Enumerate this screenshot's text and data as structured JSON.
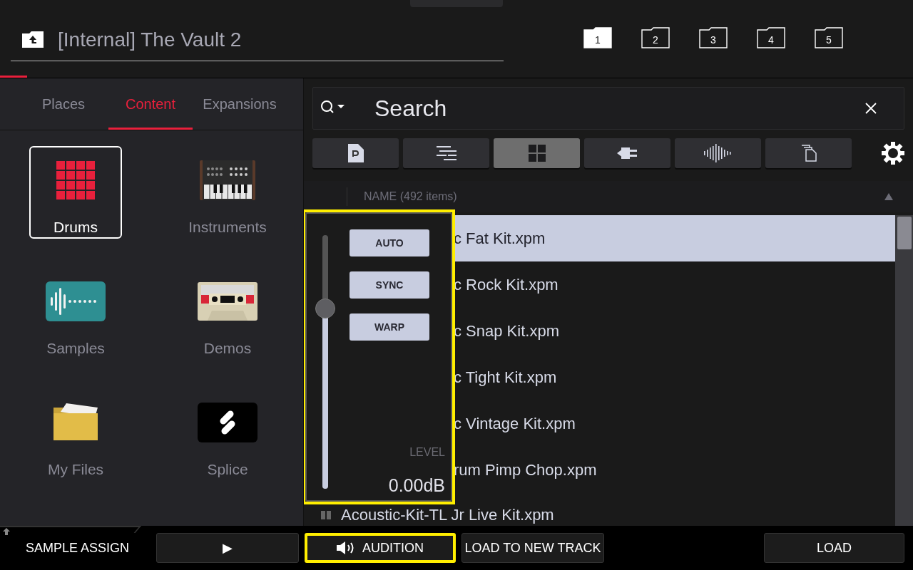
{
  "header": {
    "path": "[Internal] The Vault 2",
    "folders": [
      {
        "label": "1",
        "selected": true
      },
      {
        "label": "2",
        "selected": false
      },
      {
        "label": "3",
        "selected": false
      },
      {
        "label": "4",
        "selected": false
      },
      {
        "label": "5",
        "selected": false
      }
    ]
  },
  "left_panel": {
    "tabs": [
      {
        "label": "Places",
        "selected": false
      },
      {
        "label": "Content",
        "selected": true
      },
      {
        "label": "Expansions",
        "selected": false
      }
    ],
    "items": [
      {
        "label": "Drums",
        "kind": "drums",
        "selected": true
      },
      {
        "label": "Instruments",
        "kind": "instruments",
        "selected": false
      },
      {
        "label": "Samples",
        "kind": "samples",
        "selected": false
      },
      {
        "label": "Demos",
        "kind": "demos",
        "selected": false
      },
      {
        "label": "My Files",
        "kind": "files",
        "selected": false
      },
      {
        "label": "Splice",
        "kind": "splice",
        "selected": false
      }
    ]
  },
  "search": {
    "placeholder": "Search"
  },
  "filters": [
    {
      "kind": "program",
      "selected": false
    },
    {
      "kind": "sequence",
      "selected": false
    },
    {
      "kind": "grid",
      "selected": true
    },
    {
      "kind": "plugin",
      "selected": false
    },
    {
      "kind": "sample",
      "selected": false
    },
    {
      "kind": "multi",
      "selected": false
    }
  ],
  "list": {
    "column": "NAME (492 items)",
    "rows": [
      {
        "name": "c Fat Kit.xpm",
        "kind": "partial",
        "selected": true
      },
      {
        "name": "c Rock Kit.xpm",
        "kind": "partial",
        "selected": false
      },
      {
        "name": "c Snap Kit.xpm",
        "kind": "partial",
        "selected": false
      },
      {
        "name": "c Tight Kit.xpm",
        "kind": "partial",
        "selected": false
      },
      {
        "name": "c Vintage Kit.xpm",
        "kind": "partial",
        "selected": false
      },
      {
        "name": "rum Pimp Chop.xpm",
        "kind": "partial",
        "selected": false
      },
      {
        "name": "Acoustic-Kit-TL Jr Live Kit.xpm",
        "kind": "full",
        "selected": false
      }
    ]
  },
  "audition_popup": {
    "highlighted": true,
    "buttons": [
      "AUTO",
      "SYNC",
      "WARP"
    ],
    "level": 0.71,
    "level_label": "LEVEL",
    "reading": "0.00dB"
  },
  "bottom_bar": {
    "mode": "SAMPLE ASSIGN",
    "buttons": [
      {
        "kind": "play",
        "label": "▶",
        "highlighted": false
      },
      {
        "kind": "audition",
        "label": "AUDITION",
        "highlighted": true
      },
      {
        "kind": "text",
        "label": "LOAD TO NEW TRACK",
        "highlighted": false
      },
      {
        "kind": "load",
        "label": "LOAD",
        "highlighted": false
      }
    ]
  }
}
